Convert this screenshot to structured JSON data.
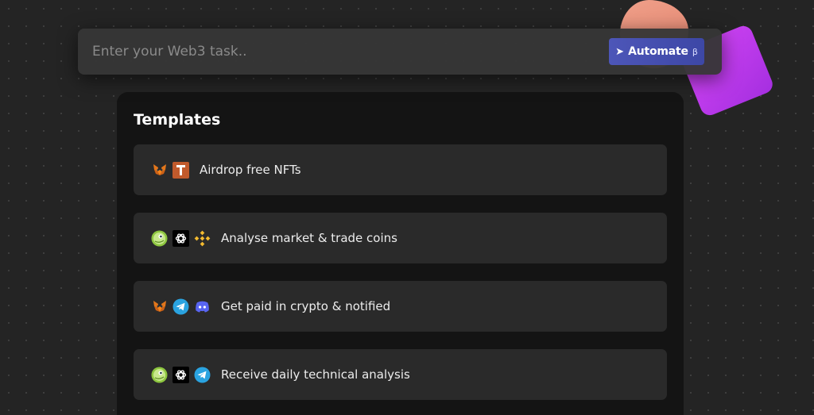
{
  "task_bar": {
    "placeholder": "Enter your Web3 task..",
    "value": "",
    "automate_label": "Automate",
    "beta_mark": "β"
  },
  "templates": {
    "title": "Templates",
    "items": [
      {
        "label": "Airdrop free NFTs",
        "icons": [
          "metamask-fox-icon",
          "t-app-icon"
        ]
      },
      {
        "label": "Analyse market & trade coins",
        "icons": [
          "coingecko-icon",
          "openai-icon",
          "binance-icon"
        ]
      },
      {
        "label": "Get paid in crypto & notified",
        "icons": [
          "metamask-fox-icon",
          "telegram-icon",
          "discord-icon"
        ]
      },
      {
        "label": "Receive daily technical analysis",
        "icons": [
          "coingecko-icon",
          "openai-icon",
          "telegram-icon"
        ]
      }
    ]
  },
  "colors": {
    "background": "#242424",
    "panel": "#141414",
    "card": "#2a2a2a",
    "accent": "#4d56b8",
    "blob_peach": "#e8907a",
    "blob_purple": "#c23cee"
  }
}
